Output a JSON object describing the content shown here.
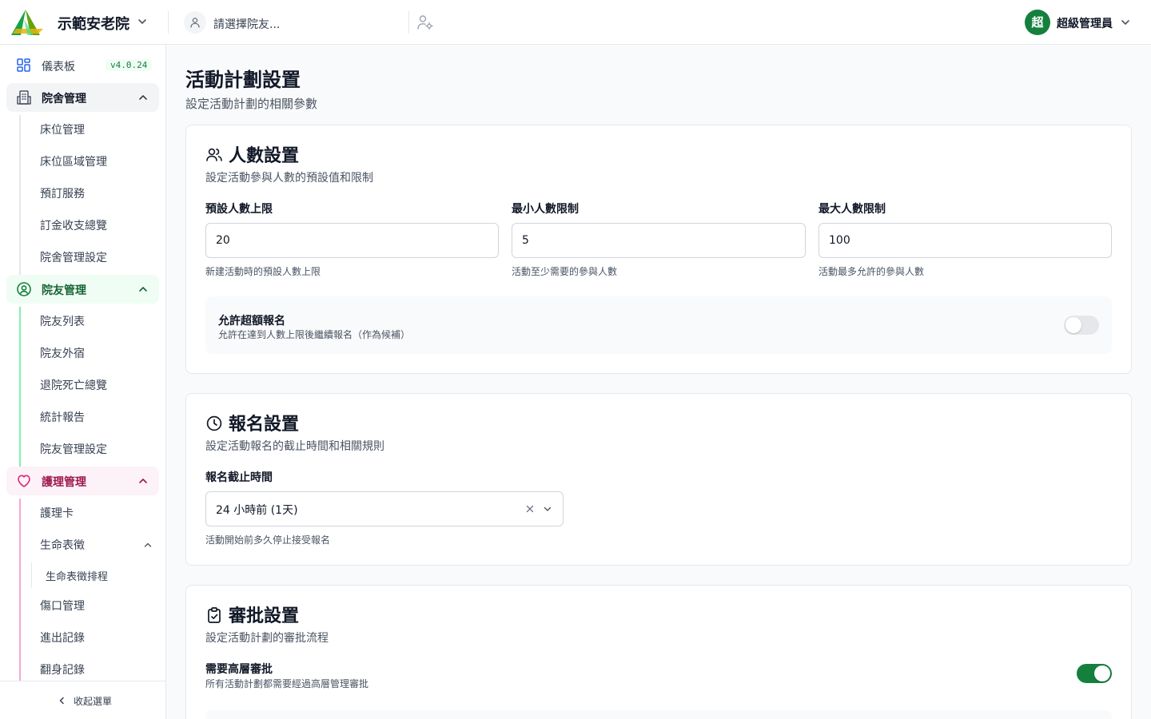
{
  "header": {
    "org_name": "示範安老院",
    "resident_placeholder": "請選擇院友...",
    "user_initial": "超",
    "user_name": "超級管理員"
  },
  "sidebar": {
    "dashboard_label": "儀表板",
    "version": "v4.0.24",
    "groups": [
      {
        "label": "院舍管理",
        "icon": "building-icon",
        "items": [
          "床位管理",
          "床位區域管理",
          "預訂服務",
          "訂金收支總覽",
          "院舍管理設定"
        ]
      },
      {
        "label": "院友管理",
        "icon": "user-circle-icon",
        "items": [
          "院友列表",
          "院友外宿",
          "退院死亡總覽",
          "統計報告",
          "院友管理設定"
        ]
      },
      {
        "label": "護理管理",
        "icon": "heart-icon",
        "items": [
          "護理卡",
          "生命表徵",
          "生命表徵排程",
          "傷口管理",
          "進出記錄",
          "翻身記錄"
        ]
      }
    ],
    "collapse_label": "收起選單"
  },
  "page": {
    "title": "活動計劃設置",
    "subtitle": "設定活動計劃的相關參數"
  },
  "headcount": {
    "title": "人數設置",
    "subtitle": "設定活動參與人數的預設值和限制",
    "fields": [
      {
        "label": "預設人數上限",
        "value": "20",
        "help": "新建活動時的預設人數上限"
      },
      {
        "label": "最小人數限制",
        "value": "5",
        "help": "活動至少需要的參與人數"
      },
      {
        "label": "最大人數限制",
        "value": "100",
        "help": "活動最多允許的參與人數"
      }
    ],
    "overbook": {
      "title": "允許超額報名",
      "desc": "允許在達到人數上限後繼續報名（作為候補）",
      "enabled": false
    }
  },
  "registration": {
    "title": "報名設置",
    "subtitle": "設定活動報名的截止時間和相關規則",
    "deadline_label": "報名截止時間",
    "deadline_value": "24 小時前 (1天)",
    "deadline_help": "活動開始前多久停止接受報名"
  },
  "approval": {
    "title": "審批設置",
    "subtitle": "設定活動計劃的審批流程",
    "senior": {
      "title": "需要高層審批",
      "desc": "所有活動計劃都需要經過高層管理審批",
      "enabled": true
    }
  },
  "colors": {
    "brand_green": "#15803d",
    "nursing_pink": "#db2777",
    "facility_gray": "#f3f4f6"
  }
}
